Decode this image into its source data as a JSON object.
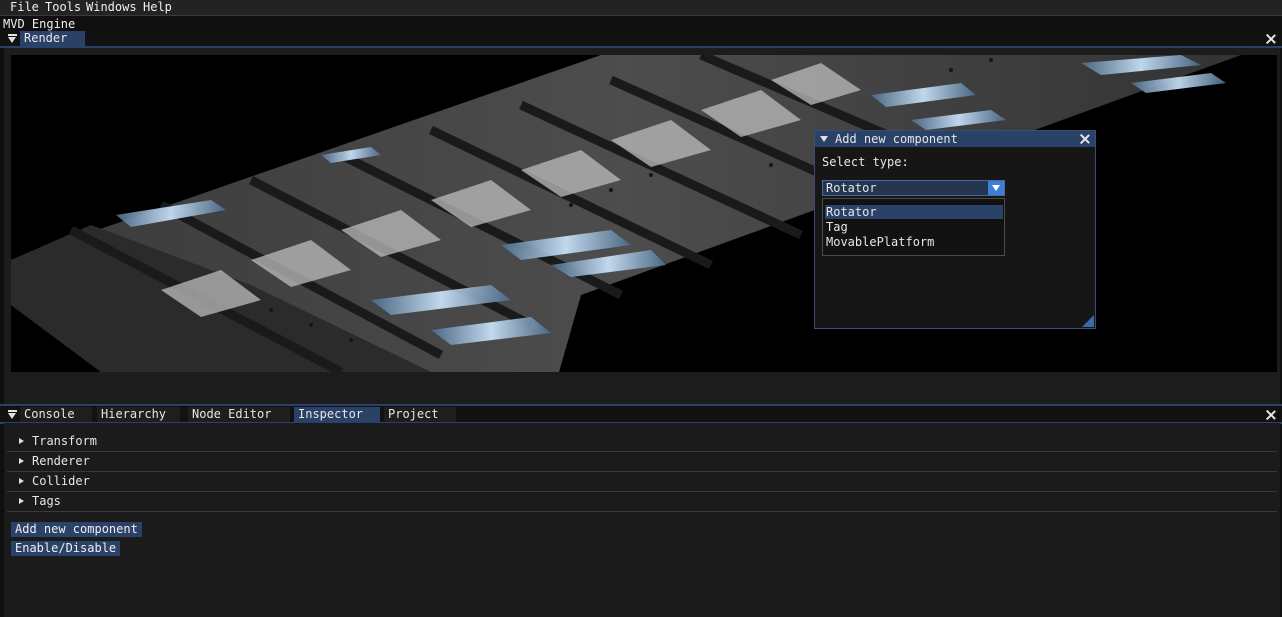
{
  "menubar": {
    "items": [
      "File",
      "Tools",
      "Windows",
      "Help"
    ]
  },
  "app_title": "MVD Engine",
  "render_panel": {
    "tab_label": "Render"
  },
  "add_component_dialog": {
    "title": "Add new component",
    "select_label": "Select type:",
    "selected_value": "Rotator",
    "options": [
      "Rotator",
      "Tag",
      "MovablePlatform"
    ]
  },
  "bottom_panel": {
    "tabs": [
      "Console",
      "Hierarchy",
      "Node Editor",
      "Inspector",
      "Project"
    ],
    "active_tab": "Inspector"
  },
  "inspector": {
    "sections": [
      "Transform",
      "Renderer",
      "Collider",
      "Tags"
    ],
    "add_component_label": "Add new component",
    "enable_disable_label": "Enable/Disable"
  },
  "colors": {
    "accent": "#2b4268",
    "combo_button": "#3d7fd8",
    "background": "#0f0f0f"
  }
}
